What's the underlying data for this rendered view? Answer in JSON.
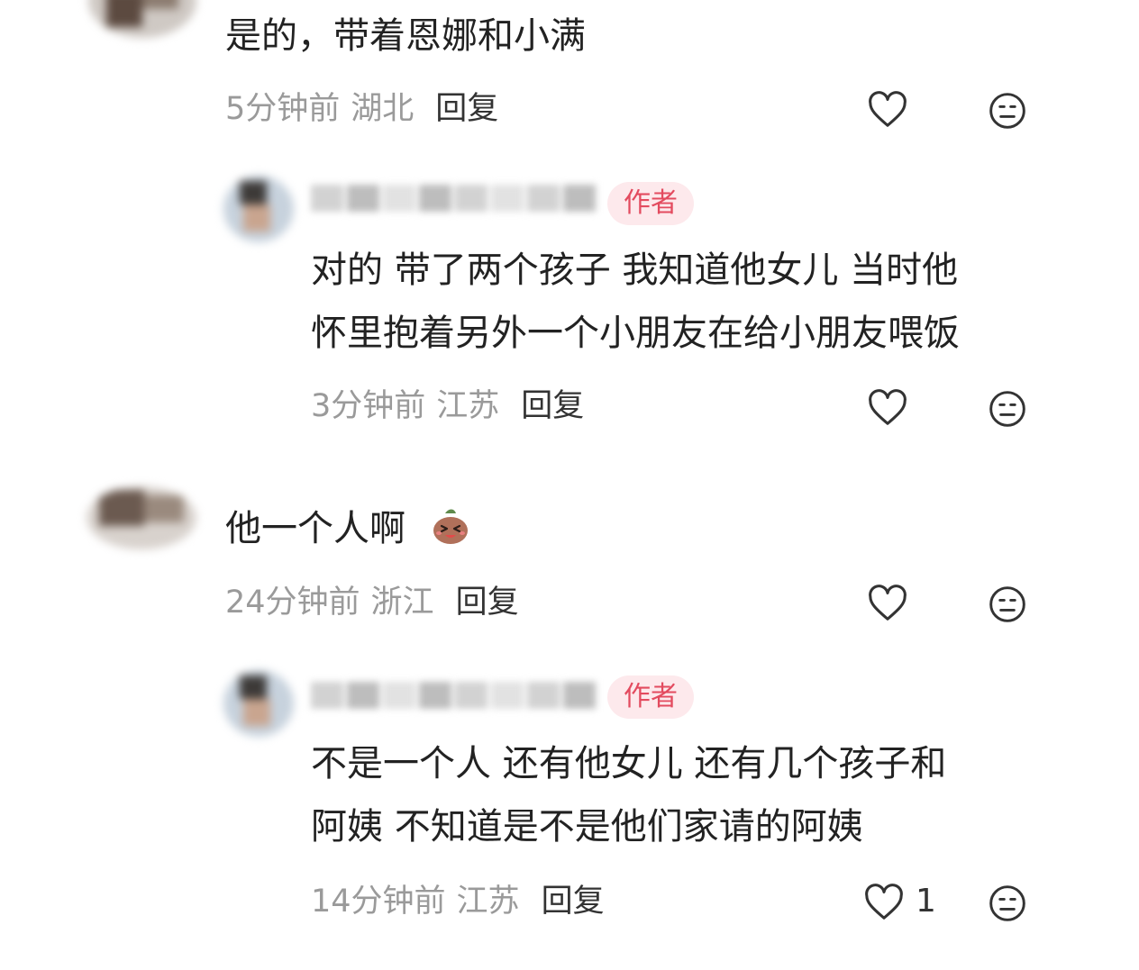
{
  "comments": [
    {
      "text_lines": [
        "是的，带着恩娜和小满"
      ],
      "time": "5分钟前",
      "location": "湖北",
      "reply_label": "回复"
    },
    {
      "badge": "作者",
      "text_lines": [
        "对的 带了两个孩子 我知道他女儿 当时他",
        "怀里抱着另外一个小朋友在给小朋友喂饭"
      ],
      "time": "3分钟前",
      "location": "江苏",
      "reply_label": "回复"
    },
    {
      "text_lines": [
        "他一个人啊"
      ],
      "emoji": "laughing-sweat-emoji",
      "time": "24分钟前",
      "location": "浙江",
      "reply_label": "回复"
    },
    {
      "badge": "作者",
      "text_lines": [
        "不是一个人 还有他女儿 还有几个孩子和",
        "阿姨 不知道是不是他们家请的阿姨"
      ],
      "time": "14分钟前",
      "location": "江苏",
      "reply_label": "回复",
      "like_count": "1"
    }
  ],
  "icons": {
    "like": "heart-outline-icon",
    "dislike": "meh-face-icon"
  },
  "colors": {
    "badge_bg": "#fde9ec",
    "badge_text": "#e34b5f",
    "meta_text": "#9a9a9a"
  }
}
